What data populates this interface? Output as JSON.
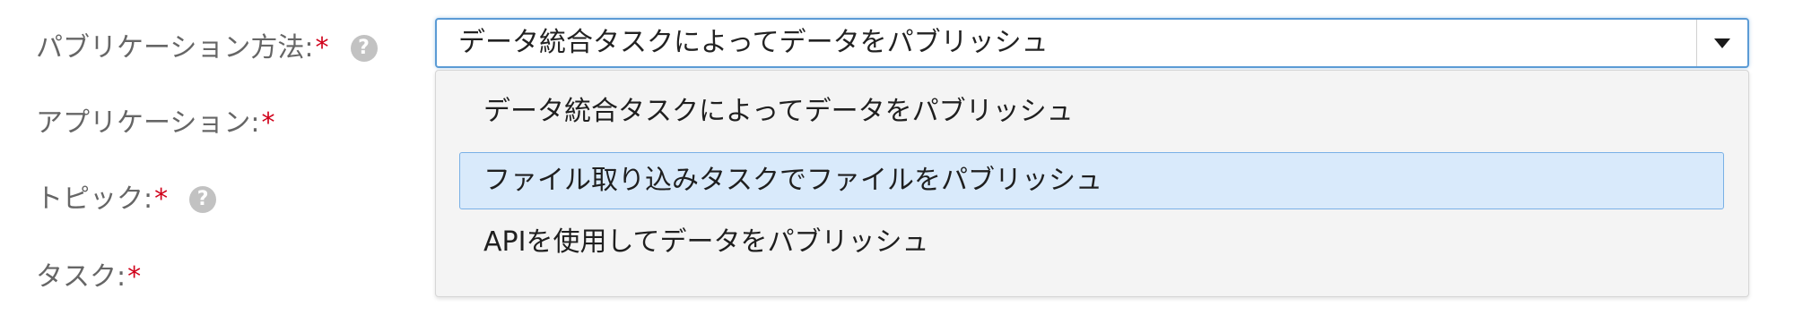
{
  "form": {
    "labels": {
      "publish_method": "パブリケーション方法:",
      "application": "アプリケーション:",
      "topic": "トピック:",
      "task": "タスク:"
    },
    "required_marker": "*",
    "help_icon_glyph": "?"
  },
  "publish_method_select": {
    "value": "データ統合タスクによってデータをパブリッシュ",
    "options": [
      {
        "label": "データ統合タスクによってデータをパブリッシュ",
        "highlighted": false
      },
      {
        "label": "ファイル取り込みタスクでファイルをパブリッシュ",
        "highlighted": true
      },
      {
        "label": "APIを使用してデータをパブリッシュ",
        "highlighted": false
      }
    ]
  },
  "colors": {
    "required": "#d0021b",
    "focus_border": "#5b9bd5",
    "option_highlight_bg": "#d9eafb",
    "option_highlight_border": "#79b0e6",
    "dropdown_bg": "#f4f4f4"
  }
}
